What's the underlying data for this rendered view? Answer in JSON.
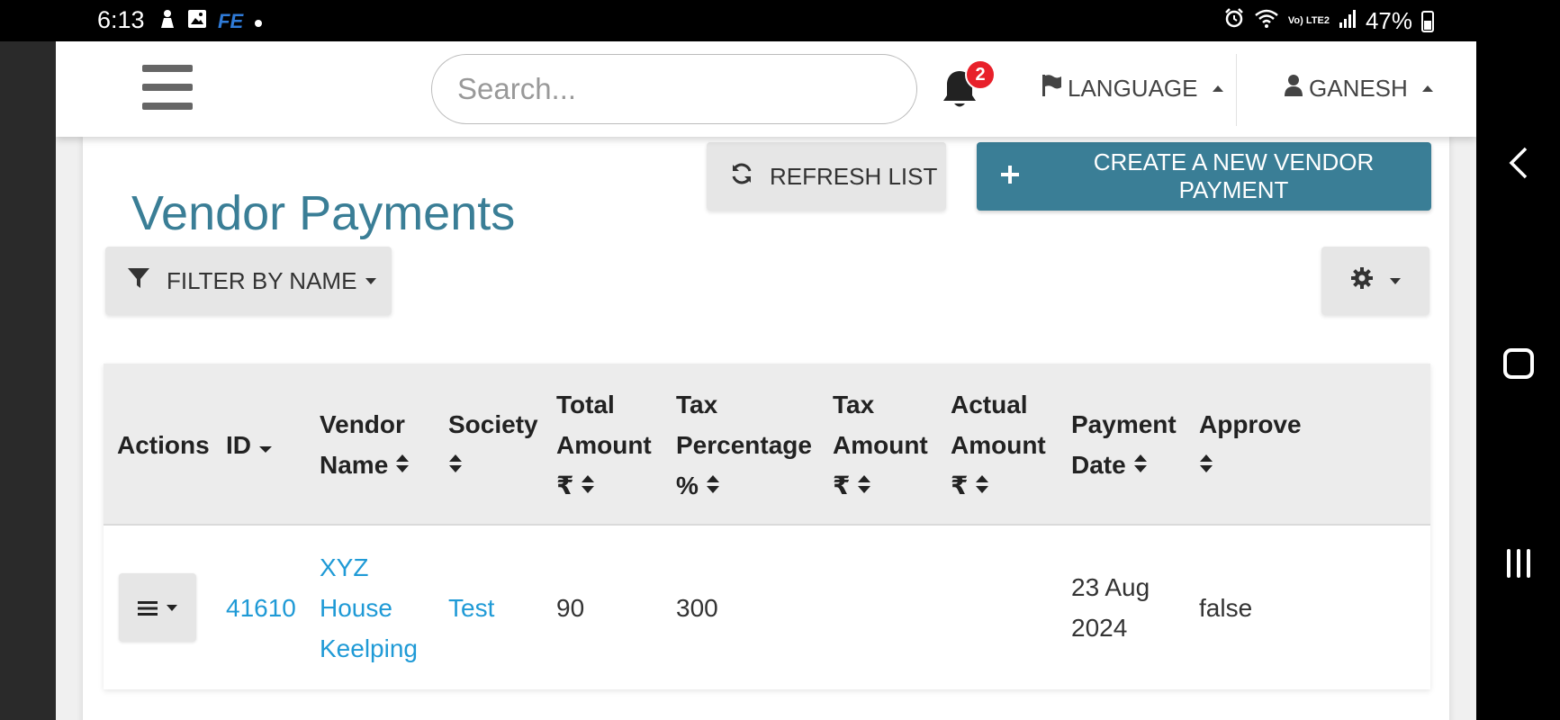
{
  "status_bar": {
    "time": "6:13",
    "app_badge": "FE",
    "battery": "47%",
    "network": "Vo) LTE2"
  },
  "header": {
    "search_placeholder": "Search...",
    "notification_count": "2",
    "language_label": "LANGUAGE",
    "user_label": "GANESH"
  },
  "page": {
    "title": "Vendor Payments",
    "refresh_label": "REFRESH LIST",
    "create_label": "CREATE A NEW VENDOR PAYMENT",
    "filter_label": "FILTER BY NAME"
  },
  "table": {
    "columns": [
      {
        "line1": "Actions",
        "line2": "",
        "line3": ""
      },
      {
        "line1": "ID",
        "line2": "",
        "line3": ""
      },
      {
        "line1": "Vendor",
        "line2": "Name",
        "line3": ""
      },
      {
        "line1": "Society",
        "line2": "",
        "line3": ""
      },
      {
        "line1": "Total",
        "line2": "Amount",
        "line3": "₹"
      },
      {
        "line1": "Tax",
        "line2": "Percentage",
        "line3": "%"
      },
      {
        "line1": "Tax",
        "line2": "Amount",
        "line3": "₹"
      },
      {
        "line1": "Actual",
        "line2": "Amount",
        "line3": "₹"
      },
      {
        "line1": "Payment",
        "line2": "Date",
        "line3": ""
      },
      {
        "line1": "Approve",
        "line2": "",
        "line3": ""
      }
    ],
    "rows": [
      {
        "id": "41610",
        "vendor_name_1": "XYZ",
        "vendor_name_2": "House",
        "vendor_name_3": "Keelping",
        "society": "Test",
        "total_amount": "90",
        "tax_percentage": "300",
        "tax_amount": "",
        "actual_amount": "",
        "payment_date_1": "23 Aug",
        "payment_date_2": "2024",
        "approve": "false"
      }
    ]
  },
  "colors": {
    "accent": "#3a7e96",
    "link": "#1f9ad6",
    "badge": "#e8202a"
  }
}
